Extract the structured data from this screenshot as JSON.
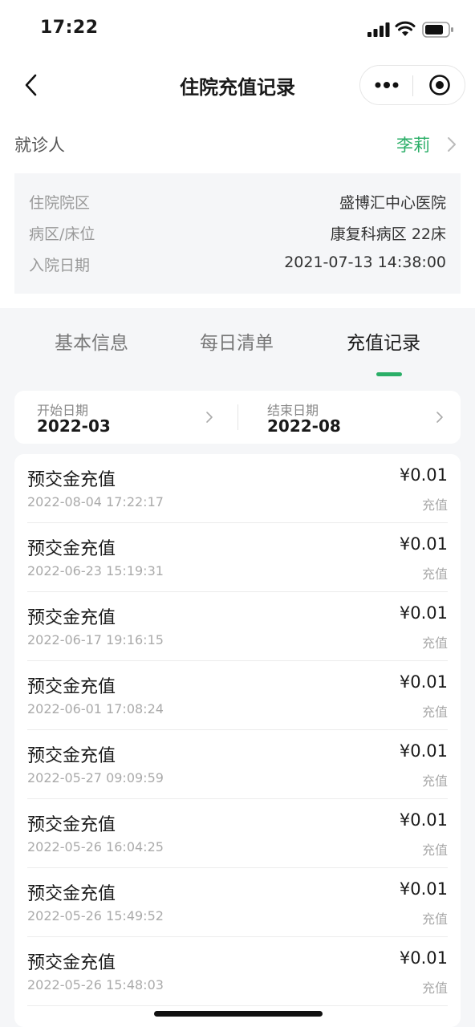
{
  "status_bar": {
    "time": "17:22"
  },
  "nav": {
    "title": "住院充值记录"
  },
  "patient": {
    "label": "就诊人",
    "name": "李莉"
  },
  "info": {
    "rows": [
      {
        "key": "住院院区",
        "value": "盛博汇中心医院"
      },
      {
        "key": "病区/床位",
        "value": "康复科病区 22床"
      },
      {
        "key": "入院日期",
        "value": "2021-07-13 14:38:00"
      }
    ]
  },
  "tabs": [
    {
      "label": "基本信息",
      "active": false
    },
    {
      "label": "每日清单",
      "active": false
    },
    {
      "label": "充值记录",
      "active": true
    }
  ],
  "filter": {
    "start_label": "开始日期",
    "start_value": "2022-03",
    "end_label": "结束日期",
    "end_value": "2022-08"
  },
  "records": [
    {
      "title": "预交金充值",
      "time": "2022-08-04 17:22:17",
      "amount": "¥0.01",
      "type": "充值"
    },
    {
      "title": "预交金充值",
      "time": "2022-06-23 15:19:31",
      "amount": "¥0.01",
      "type": "充值"
    },
    {
      "title": "预交金充值",
      "time": "2022-06-17 19:16:15",
      "amount": "¥0.01",
      "type": "充值"
    },
    {
      "title": "预交金充值",
      "time": "2022-06-01 17:08:24",
      "amount": "¥0.01",
      "type": "充值"
    },
    {
      "title": "预交金充值",
      "time": "2022-05-27 09:09:59",
      "amount": "¥0.01",
      "type": "充值"
    },
    {
      "title": "预交金充值",
      "time": "2022-05-26 16:04:25",
      "amount": "¥0.01",
      "type": "充值"
    },
    {
      "title": "预交金充值",
      "time": "2022-05-26 15:49:52",
      "amount": "¥0.01",
      "type": "充值"
    },
    {
      "title": "预交金充值",
      "time": "2022-05-26 15:48:03",
      "amount": "¥0.01",
      "type": "充值"
    }
  ],
  "colors": {
    "accent": "#2aae67",
    "background": "#f5f6f8"
  },
  "icons": [
    "signal-icon",
    "wifi-icon",
    "battery-icon",
    "back-arrow-icon",
    "more-dots-icon",
    "close-target-icon",
    "chevron-right-icon"
  ]
}
